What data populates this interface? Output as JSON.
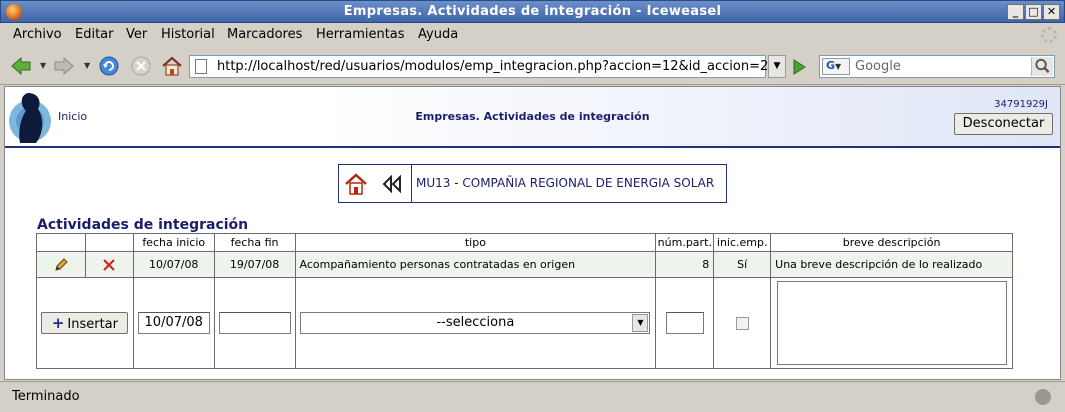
{
  "window": {
    "title": "Empresas. Actividades de integración - Iceweasel"
  },
  "menu": {
    "items": [
      "Archivo",
      "Editar",
      "Ver",
      "Historial",
      "Marcadores",
      "Herramientas",
      "Ayuda"
    ]
  },
  "navbar": {
    "url": "http://localhost/red/usuarios/modulos/emp_integracion.php?accion=12&id_accion=2",
    "search_placeholder": "Google",
    "search_engine_letter": "G"
  },
  "header": {
    "home_link": "Inicio",
    "heading": "Empresas. Actividades de integración",
    "user_id": "34791929J",
    "logout_label": "Desconectar"
  },
  "company": {
    "label": "MU13 - COMPAÑIA REGIONAL DE ENERGIA SOLAR"
  },
  "section": {
    "title": "Actividades de integración"
  },
  "table": {
    "headers": [
      "fecha inicio",
      "fecha fin",
      "tipo",
      "núm.part.",
      "inic.emp.",
      "breve descripción"
    ],
    "rows": [
      {
        "fecha_inicio": "10/07/08",
        "fecha_fin": "19/07/08",
        "tipo": "Acompañamiento personas contratadas en origen",
        "num_part": "8",
        "inic_emp": "Sí",
        "descripcion": "Una breve descripción de lo realizado"
      }
    ],
    "form": {
      "insert_label": "Insertar",
      "fecha_inicio_value": "10/07/08",
      "fecha_fin_value": "",
      "tipo_selected": "--selecciona",
      "num_part_value": ""
    }
  },
  "status": {
    "text": "Terminado"
  },
  "colors": {
    "navy": "#1a1e6b",
    "row_green": "#edf4ec",
    "title_blue": "#3f64a8"
  }
}
